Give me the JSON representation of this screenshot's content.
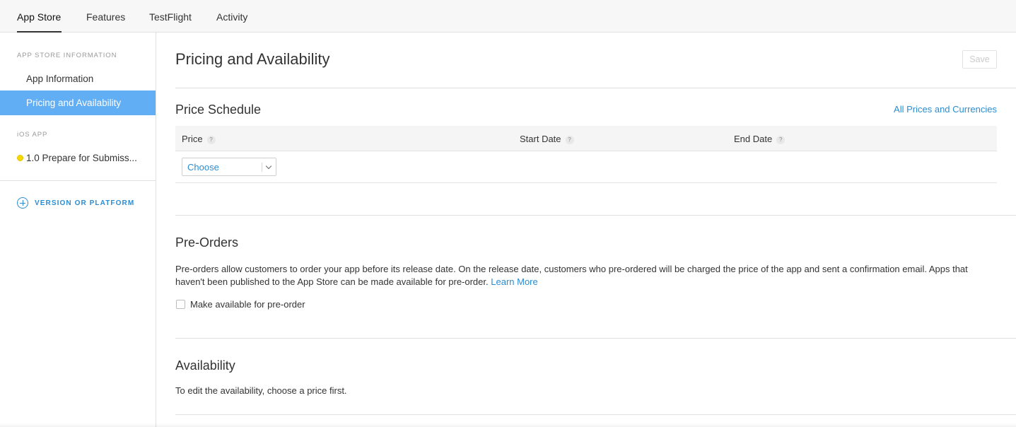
{
  "top_tabs": [
    {
      "label": "App Store",
      "active": true
    },
    {
      "label": "Features",
      "active": false
    },
    {
      "label": "TestFlight",
      "active": false
    },
    {
      "label": "Activity",
      "active": false
    }
  ],
  "sidebar": {
    "section_app_store": "APP STORE INFORMATION",
    "items": [
      {
        "label": "App Information",
        "selected": false
      },
      {
        "label": "Pricing and Availability",
        "selected": true
      }
    ],
    "section_ios": "iOS APP",
    "version_item": {
      "label": "1.0 Prepare for Submiss...",
      "status_color": "#f6d800"
    },
    "add_version_label": "VERSION OR PLATFORM",
    "add_icon": "plus-circle-icon"
  },
  "main": {
    "page_title": "Pricing and Availability",
    "save_label": "Save",
    "price_schedule": {
      "title": "Price Schedule",
      "link_label": "All Prices and Currencies",
      "columns": [
        {
          "label": "Price",
          "help": "?"
        },
        {
          "label": "Start Date",
          "help": "?"
        },
        {
          "label": "End Date",
          "help": "?"
        }
      ],
      "price_select_value": "Choose",
      "select_icon": "chevron-down-icon"
    },
    "pre_orders": {
      "title": "Pre-Orders",
      "description": "Pre-orders allow customers to order your app before its release date. On the release date, customers who pre-ordered will be charged the price of the app and sent a confirmation email. Apps that haven't been published to the App Store can be made available for pre-order.",
      "learn_more": "Learn More",
      "checkbox_label": "Make available for pre-order",
      "checked": false
    },
    "availability": {
      "title": "Availability",
      "text": "To edit the availability, choose a price first."
    }
  },
  "colors": {
    "accent": "#2a8dd4",
    "selected_bg": "#61aef5",
    "status_yellow": "#f6d800"
  }
}
